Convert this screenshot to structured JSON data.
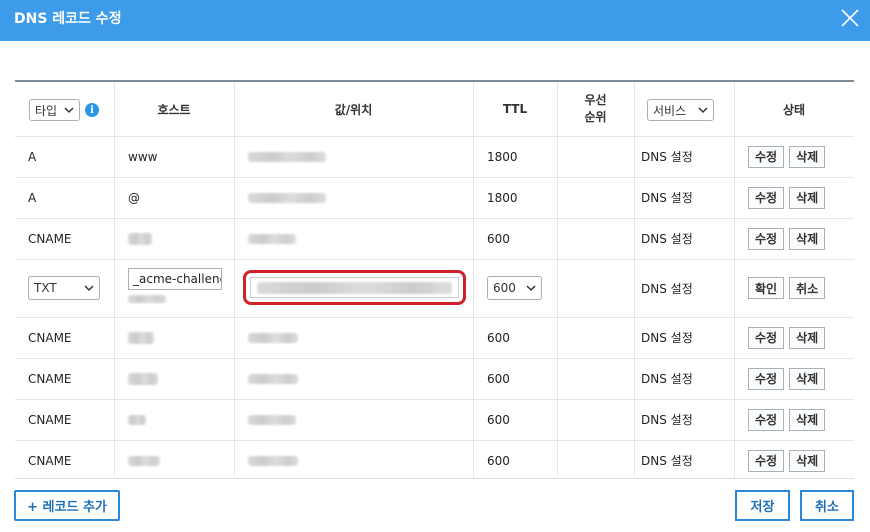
{
  "dialog": {
    "title": "DNS 레코드 수정",
    "header_color": "#3d9be9",
    "accent": "#2b87d7",
    "highlight": "#d0202a"
  },
  "table": {
    "headers": {
      "type_filter": "타입",
      "host": "호스트",
      "value": "값/위치",
      "ttl": "TTL",
      "priority_line1": "우선",
      "priority_line2": "순위",
      "service_filter": "서비스",
      "status": "상태"
    },
    "rows": [
      {
        "type": "A",
        "host": "www",
        "value_blurred": true,
        "ttl": "1800",
        "service": "DNS 설정",
        "actions": [
          "수정",
          "삭제"
        ]
      },
      {
        "type": "A",
        "host": "@",
        "value_blurred": true,
        "ttl": "1800",
        "service": "DNS 설정",
        "actions": [
          "수정",
          "삭제"
        ]
      },
      {
        "type": "CNAME",
        "host_blurred": true,
        "value_blurred": true,
        "ttl": "600",
        "service": "DNS 설정",
        "actions": [
          "수정",
          "삭제"
        ]
      },
      {
        "editing": true,
        "type_select": "TXT",
        "host_input": "_acme-challenge",
        "value_blurred": true,
        "ttl_select": "600",
        "service": "DNS 설정",
        "actions": [
          "확인",
          "취소"
        ]
      },
      {
        "type": "CNAME",
        "host_blurred": true,
        "value_blurred": true,
        "ttl": "600",
        "service": "DNS 설정",
        "actions": [
          "수정",
          "삭제"
        ]
      },
      {
        "type": "CNAME",
        "host_blurred": true,
        "value_blurred": true,
        "ttl": "600",
        "service": "DNS 설정",
        "actions": [
          "수정",
          "삭제"
        ]
      },
      {
        "type": "CNAME",
        "host_blurred": true,
        "value_blurred": true,
        "ttl": "600",
        "service": "DNS 설정",
        "actions": [
          "수정",
          "삭제"
        ]
      },
      {
        "type": "CNAME",
        "host_blurred": true,
        "value_blurred": true,
        "ttl": "600",
        "service": "DNS 설정",
        "actions": [
          "수정",
          "삭제"
        ]
      }
    ]
  },
  "footer": {
    "add_record": "+ 레코드 추가",
    "save": "저장",
    "cancel": "취소"
  },
  "icons": {
    "close": "close-icon",
    "info": "info-icon",
    "dropdown": "chevron-down-icon"
  },
  "info_glyph": "i"
}
